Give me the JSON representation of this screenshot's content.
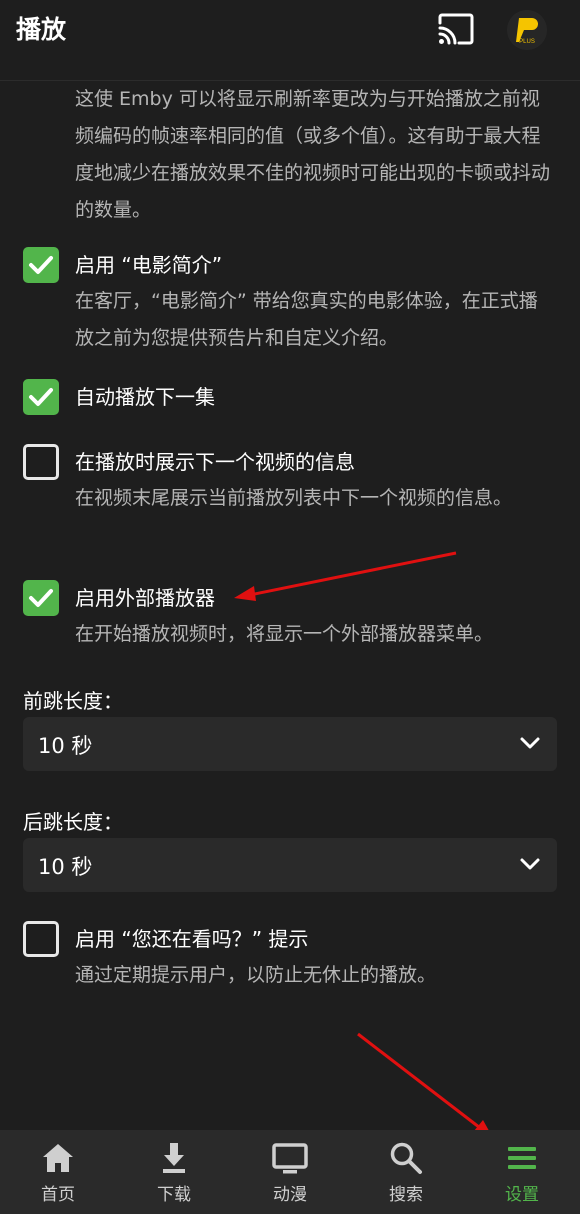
{
  "header": {
    "title": "播放",
    "cast_icon": "cast-icon",
    "avatar_text": "PLUS"
  },
  "top_description": "这使 Emby 可以将显示刷新率更改为与开始播放之前视频编码的帧速率相同的值（或多个值）。这有助于最大程度地减少在播放效果不佳的视频时可能出现的卡顿或抖动的数量。",
  "options": [
    {
      "label": "启用 “电影简介”",
      "checked": true,
      "description": "在客厅，“电影简介” 带给您真实的电影体验，在正式播放之前为您提供预告片和自定义介绍。"
    },
    {
      "label": "自动播放下一集",
      "checked": true,
      "description": ""
    },
    {
      "label": "在播放时展示下一个视频的信息",
      "checked": false,
      "description": "在视频末尾展示当前播放列表中下一个视频的信息。"
    },
    {
      "label": "启用外部播放器",
      "checked": true,
      "description": "在开始播放视频时，将显示一个外部播放器菜单。"
    }
  ],
  "skip_forward": {
    "label": "前跳长度：",
    "value": "10 秒"
  },
  "skip_back": {
    "label": "后跳长度：",
    "value": "10 秒"
  },
  "still_watching": {
    "label": "启用 “您还在看吗？” 提示",
    "checked": false,
    "description": "通过定期提示用户，以防止无休止的播放。"
  },
  "nav": [
    {
      "label": "首页",
      "icon": "home-icon",
      "active": false
    },
    {
      "label": "下载",
      "icon": "download-icon",
      "active": false
    },
    {
      "label": "动漫",
      "icon": "tv-icon",
      "active": false
    },
    {
      "label": "搜索",
      "icon": "search-icon",
      "active": false
    },
    {
      "label": "设置",
      "icon": "menu-icon",
      "active": true
    }
  ],
  "colors": {
    "accent": "#52b54b",
    "background": "#1e1e1e",
    "annotation": "#e01010"
  }
}
